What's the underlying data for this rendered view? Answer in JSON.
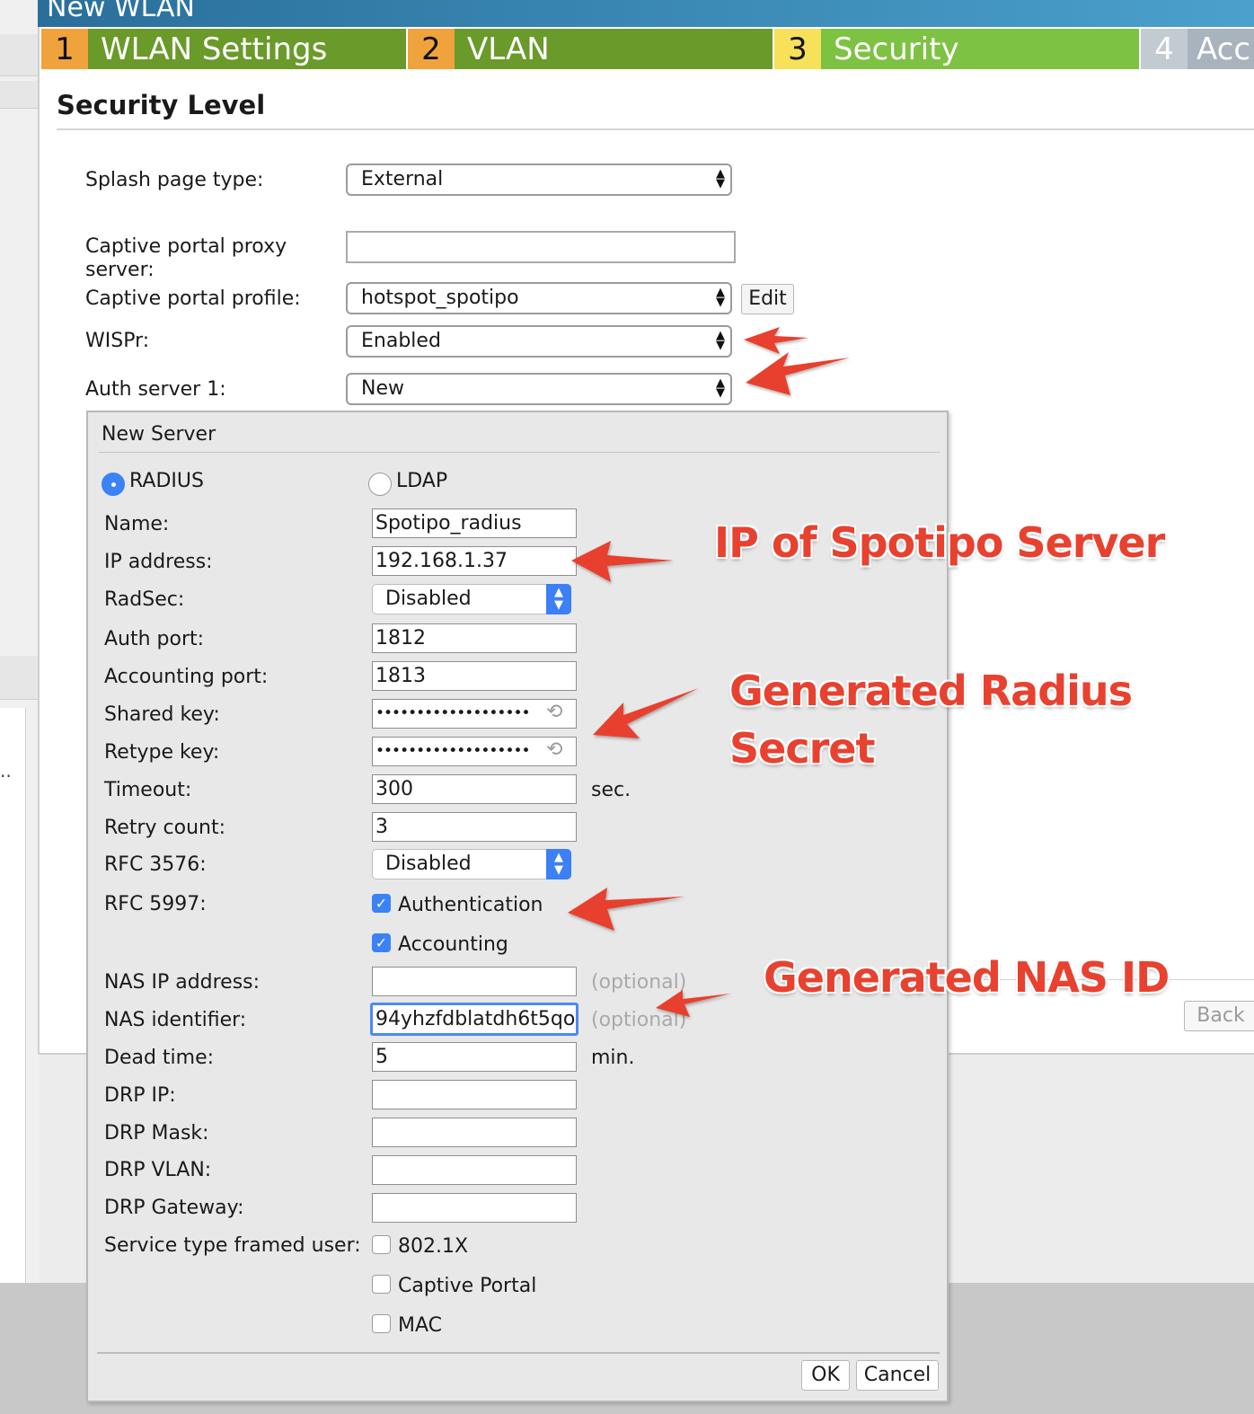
{
  "window": {
    "title": "New WLAN"
  },
  "steps": [
    {
      "num": "1",
      "label": "WLAN Settings"
    },
    {
      "num": "2",
      "label": "VLAN"
    },
    {
      "num": "3",
      "label": "Security"
    },
    {
      "num": "4",
      "label": "Acc"
    }
  ],
  "section_title": "Security Level",
  "form": {
    "splash_label": "Splash page type:",
    "splash_value": "External",
    "proxy_label_1": "Captive portal proxy",
    "proxy_label_2": "server:",
    "proxy_value": "",
    "profile_label": "Captive portal profile:",
    "profile_value": "hotspot_spotipo",
    "edit_button": "Edit",
    "wispr_label": "WISPr:",
    "wispr_value": "Enabled",
    "auth1_label": "Auth server 1:",
    "auth1_value": "New"
  },
  "back_button": "Back",
  "dialog": {
    "title": "New Server",
    "radio_radius": "RADIUS",
    "radio_ldap": "LDAP",
    "fields": {
      "name": {
        "label": "Name:",
        "value": "Spotipo_radius"
      },
      "ip": {
        "label": "IP address:",
        "value": "192.168.1.37"
      },
      "radsec": {
        "label": "RadSec:",
        "value": "Disabled"
      },
      "auth_port": {
        "label": "Auth port:",
        "value": "1812"
      },
      "acct_port": {
        "label": "Accounting port:",
        "value": "1813"
      },
      "shared_key": {
        "label": "Shared key:",
        "value": "•••••••••••••••••••"
      },
      "retype_key": {
        "label": "Retype key:",
        "value": "•••••••••••••••••••"
      },
      "timeout": {
        "label": "Timeout:",
        "value": "300",
        "unit": "sec."
      },
      "retry": {
        "label": "Retry count:",
        "value": "3"
      },
      "rfc3576": {
        "label": "RFC 3576:",
        "value": "Disabled"
      },
      "rfc5997": {
        "label": "RFC 5997:",
        "opt1": "Authentication",
        "opt2": "Accounting"
      },
      "nas_ip": {
        "label": "NAS IP address:",
        "value": "",
        "hint": "(optional)"
      },
      "nas_id": {
        "label": "NAS identifier:",
        "value": "94yhzfdblatdh6t5qo",
        "hint": "(optional)"
      },
      "dead_time": {
        "label": "Dead time:",
        "value": "5",
        "unit": "min."
      },
      "drp_ip": {
        "label": "DRP IP:",
        "value": ""
      },
      "drp_mask": {
        "label": "DRP Mask:",
        "value": ""
      },
      "drp_vlan": {
        "label": "DRP VLAN:",
        "value": ""
      },
      "drp_gw": {
        "label": "DRP Gateway:",
        "value": ""
      },
      "service_type": {
        "label": "Service type framed user:",
        "opt1": "802.1X",
        "opt2": "Captive Portal",
        "opt3": "MAC"
      }
    },
    "ok_button": "OK",
    "cancel_button": "Cancel"
  },
  "annotations": {
    "ip_note": "IP of Spotipo Server",
    "secret_note_1": "Generated Radius",
    "secret_note_2": "Secret",
    "nas_note": "Generated NAS ID"
  },
  "colors": {
    "step_done": "#6a9a2a",
    "step_active": "#7dc242",
    "step_num_done": "#f0a23c",
    "step_num_active": "#f7e05a",
    "step_future": "#a8b3bd",
    "annotation": "#e8412f",
    "accent": "#3b82f6"
  }
}
